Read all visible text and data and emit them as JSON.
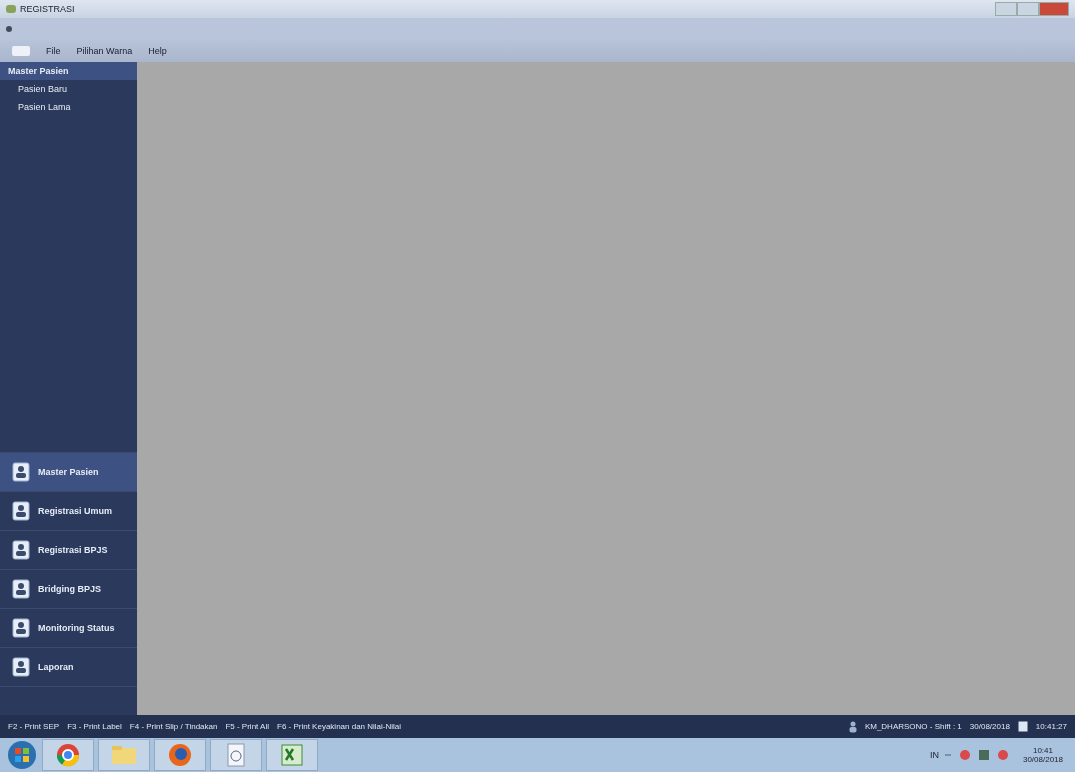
{
  "window": {
    "title": "REGISTRASI"
  },
  "menu": [
    "File",
    "Pilihan Warna",
    "Help"
  ],
  "sidebar": {
    "group_title": "Master Pasien",
    "items": [
      {
        "label": "Pasien Baru"
      },
      {
        "label": "Pasien Lama"
      }
    ],
    "nav": [
      {
        "label": "Master Pasien",
        "selected": true
      },
      {
        "label": "Registrasi Umum",
        "selected": false
      },
      {
        "label": "Registrasi BPJS",
        "selected": false
      },
      {
        "label": "Bridging BPJS",
        "selected": false
      },
      {
        "label": "Monitoring Status",
        "selected": false
      },
      {
        "label": "Laporan",
        "selected": false
      }
    ]
  },
  "status_bar": {
    "shortcuts": [
      "F2 - Print SEP",
      "F3 - Print Label",
      "F4 - Print Slip / Tindakan",
      "F5 - Print All",
      "F6 - Print Keyakinan dan Nilai-Nilai"
    ],
    "user": "KM_DHARSONO - Shift : 1",
    "date": "30/08/2018",
    "time": "10:41:27"
  },
  "taskbar": {
    "tray": {
      "language": "IN",
      "time": "10:41",
      "date": "30/08/2018"
    }
  }
}
